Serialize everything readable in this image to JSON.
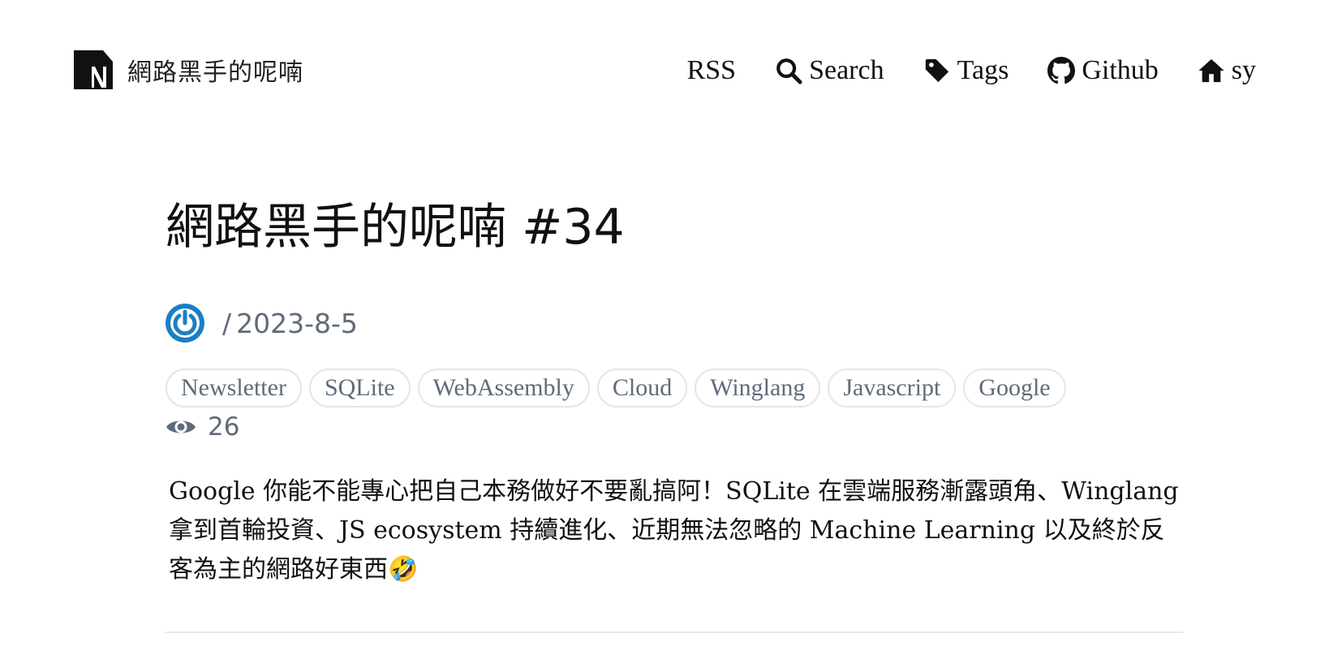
{
  "header": {
    "brand_name": "網路黑手的呢喃",
    "nav": [
      {
        "label": "RSS",
        "icon": ""
      },
      {
        "label": "Search",
        "icon": "search-icon"
      },
      {
        "label": "Tags",
        "icon": "tag-icon"
      },
      {
        "label": "Github",
        "icon": "github-icon"
      },
      {
        "label": "sy",
        "icon": "home-icon"
      }
    ]
  },
  "post": {
    "title": "網路黑手的呢喃 #34",
    "date_separator": "/",
    "date": "2023-8-5",
    "tags": [
      "Newsletter",
      "SQLite",
      "WebAssembly",
      "Cloud",
      "Winglang",
      "Javascript",
      "Google"
    ],
    "views": "26",
    "summary": "Google 你能不能專心把自己本務做好不要亂搞阿！SQLite 在雲端服務漸露頭角、Winglang 拿到首輪投資、JS ecosystem 持續進化、近期無法忽略的 Machine Learning 以及終於反客為主的網路好東西🤣"
  },
  "colors": {
    "text": "#111111",
    "muted": "#5f6b7a",
    "tag_border": "#e3e6ea",
    "avatar_blue": "#1b7fc4"
  }
}
